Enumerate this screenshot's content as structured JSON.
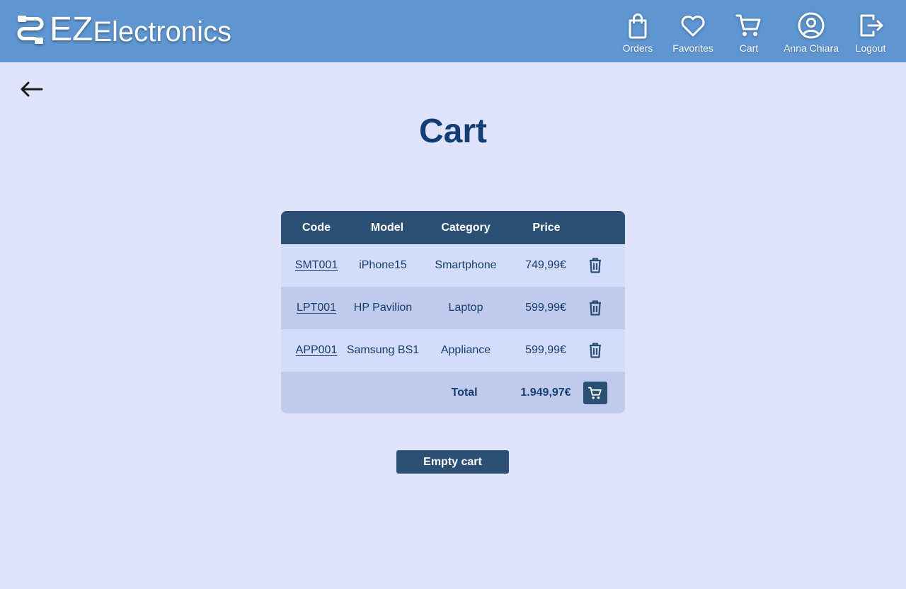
{
  "brand": {
    "prefix": "EZ",
    "suffix": "Electronics",
    "icon": "cable-connector-icon"
  },
  "nav": {
    "orders": {
      "label": "Orders",
      "icon": "shopping-bag-icon"
    },
    "favorites": {
      "label": "Favorites",
      "icon": "heart-icon"
    },
    "cart": {
      "label": "Cart",
      "icon": "cart-icon"
    },
    "user": {
      "label": "Anna Chiara",
      "icon": "user-circle-icon"
    },
    "logout": {
      "label": "Logout",
      "icon": "logout-icon"
    }
  },
  "page": {
    "title": "Cart",
    "back_icon": "arrow-left-icon"
  },
  "table": {
    "headers": [
      "Code",
      "Model",
      "Category",
      "Price"
    ],
    "rows": [
      {
        "code": "SMT001",
        "model": "iPhone15",
        "category": "Smartphone",
        "price": "749,99€"
      },
      {
        "code": "LPT001",
        "model": "HP Pavilion",
        "category": "Laptop",
        "price": "599,99€"
      },
      {
        "code": "APP001",
        "model": "Samsung BS1",
        "category": "Appliance",
        "price": "599,99€"
      }
    ],
    "total_label": "Total",
    "total_value": "1.949,97€"
  },
  "actions": {
    "empty_cart": "Empty cart"
  },
  "colors": {
    "header_bg": "#5f96d1",
    "page_bg": "#dfe3fb",
    "primary": "#2b5074",
    "title": "#133e73",
    "row_light": "#d3dcfb",
    "row_dark": "#bfcaec"
  }
}
